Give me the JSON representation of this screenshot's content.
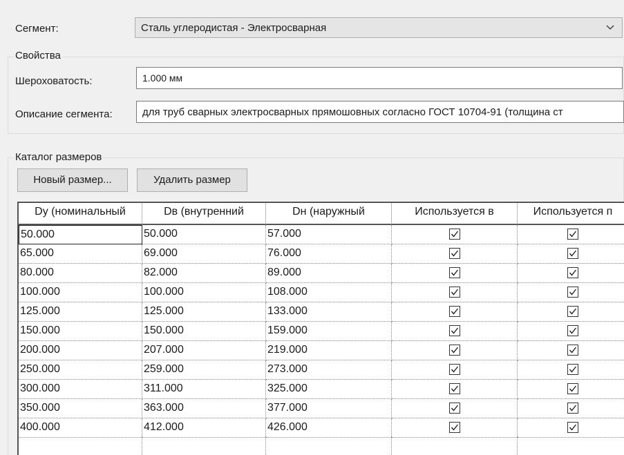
{
  "segment": {
    "label": "Сегмент:",
    "selected": "Сталь углеродистая - Электросварная"
  },
  "properties": {
    "title": "Свойства",
    "roughness_label": "Шероховатость:",
    "roughness_value": "1.000 мм",
    "description_label": "Описание сегмента:",
    "description_value": "для труб сварных электросварных прямошовных согласно ГОСТ 10704-91 (толщина ст"
  },
  "catalog": {
    "title": "Каталог размеров",
    "new_size_button": "Новый размер...",
    "delete_size_button": "Удалить размер",
    "columns": [
      "Dy (номинальный",
      "Dв (внутренний",
      "Dн (наружный",
      "Используется в",
      "Используется п"
    ],
    "rows": [
      [
        "50.000",
        "50.000",
        "57.000"
      ],
      [
        "65.000",
        "69.000",
        "76.000"
      ],
      [
        "80.000",
        "82.000",
        "89.000"
      ],
      [
        "100.000",
        "100.000",
        "108.000"
      ],
      [
        "125.000",
        "125.000",
        "133.000"
      ],
      [
        "150.000",
        "150.000",
        "159.000"
      ],
      [
        "200.000",
        "207.000",
        "219.000"
      ],
      [
        "250.000",
        "259.000",
        "273.000"
      ],
      [
        "300.000",
        "311.000",
        "325.000"
      ],
      [
        "350.000",
        "363.000",
        "377.000"
      ],
      [
        "400.000",
        "412.000",
        "426.000"
      ]
    ]
  }
}
